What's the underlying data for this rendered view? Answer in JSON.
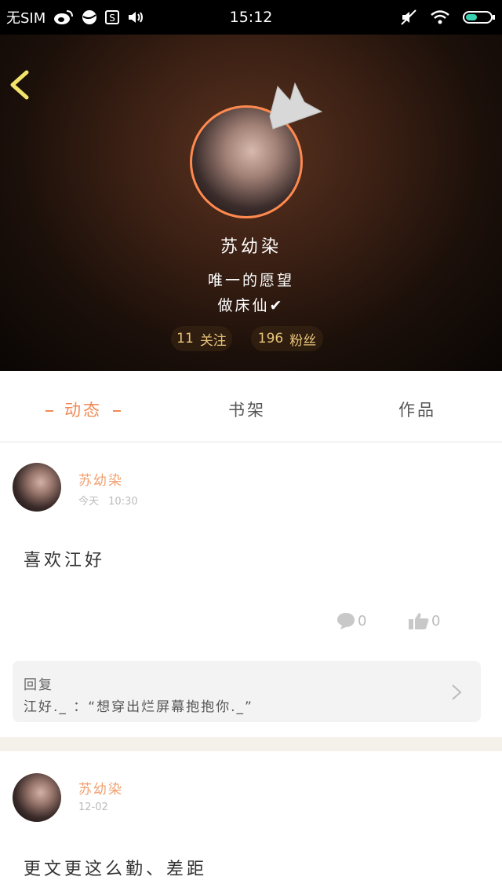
{
  "status_bar": {
    "carrier": "无SIM",
    "time": "15:12",
    "icons_left": [
      "weibo-icon",
      "ball-icon",
      "s-app-icon",
      "speaker-icon"
    ],
    "icons_right": [
      "mute-icon",
      "wifi-icon",
      "battery-icon"
    ]
  },
  "profile": {
    "name": "苏幼染",
    "bio_line1": "唯一的愿望",
    "bio_line2": "做床仙✔",
    "following_count": "11",
    "following_label": "关注",
    "fans_count": "196",
    "fans_label": "粉丝",
    "avatar_border_color": "#ff8a4f"
  },
  "tabs": [
    {
      "label": "动态",
      "active": true
    },
    {
      "label": "书架",
      "active": false
    },
    {
      "label": "作品",
      "active": false
    }
  ],
  "posts": [
    {
      "author": "苏幼染",
      "meta_label": "今天",
      "time": "10:30",
      "content": "喜欢江好",
      "comments": "0",
      "likes": "0",
      "reply_title": "回复",
      "reply_text": "江好._ ：“想穿出烂屏幕抱抱你._”"
    },
    {
      "author": "苏幼染",
      "date": "12-02",
      "content": "更文更这么勤、差距"
    }
  ],
  "colors": {
    "accent": "#f08a55",
    "stat_text": "#e8c37a"
  }
}
